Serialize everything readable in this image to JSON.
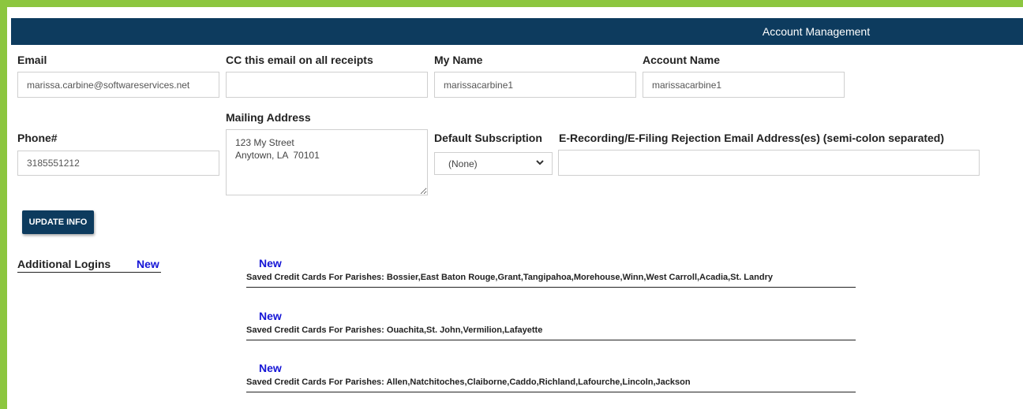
{
  "header": {
    "title": "Account Management"
  },
  "form": {
    "email": {
      "label": "Email",
      "value": "marissa.carbine@softwareservices.net"
    },
    "cc_email": {
      "label": "CC this email on all receipts",
      "value": ""
    },
    "my_name": {
      "label": "My Name",
      "value": "marissacarbine1"
    },
    "account_name": {
      "label": "Account Name",
      "value": "marissacarbine1"
    },
    "phone": {
      "label": "Phone#",
      "value": "3185551212"
    },
    "mailing_address": {
      "label": "Mailing Address",
      "value": "123 My Street\nAnytown, LA  70101"
    },
    "default_subscription": {
      "label": "Default Subscription",
      "value": "(None)"
    },
    "rejection_emails": {
      "label": "E-Recording/E-Filing Rejection Email Address(es) (semi-colon separated)",
      "value": ""
    },
    "update_button": "UPDATE INFO"
  },
  "additional_logins": {
    "label": "Additional Logins",
    "new_link": "New"
  },
  "saved_cards": [
    {
      "new_link": "New",
      "text": "Saved Credit Cards For Parishes: Bossier,East Baton Rouge,Grant,Tangipahoa,Morehouse,Winn,West Carroll,Acadia,St. Landry"
    },
    {
      "new_link": "New",
      "text": "Saved Credit Cards For Parishes: Ouachita,St. John,Vermilion,Lafayette"
    },
    {
      "new_link": "New",
      "text": "Saved Credit Cards For Parishes: Allen,Natchitoches,Claiborne,Caddo,Richland,Lafourche,Lincoln,Jackson"
    }
  ],
  "colors": {
    "header_bg": "#0d3b5e",
    "frame": "#8cc63f",
    "link": "#1515d6"
  },
  "icons": {
    "select_arrow": "chevron-down-icon"
  }
}
